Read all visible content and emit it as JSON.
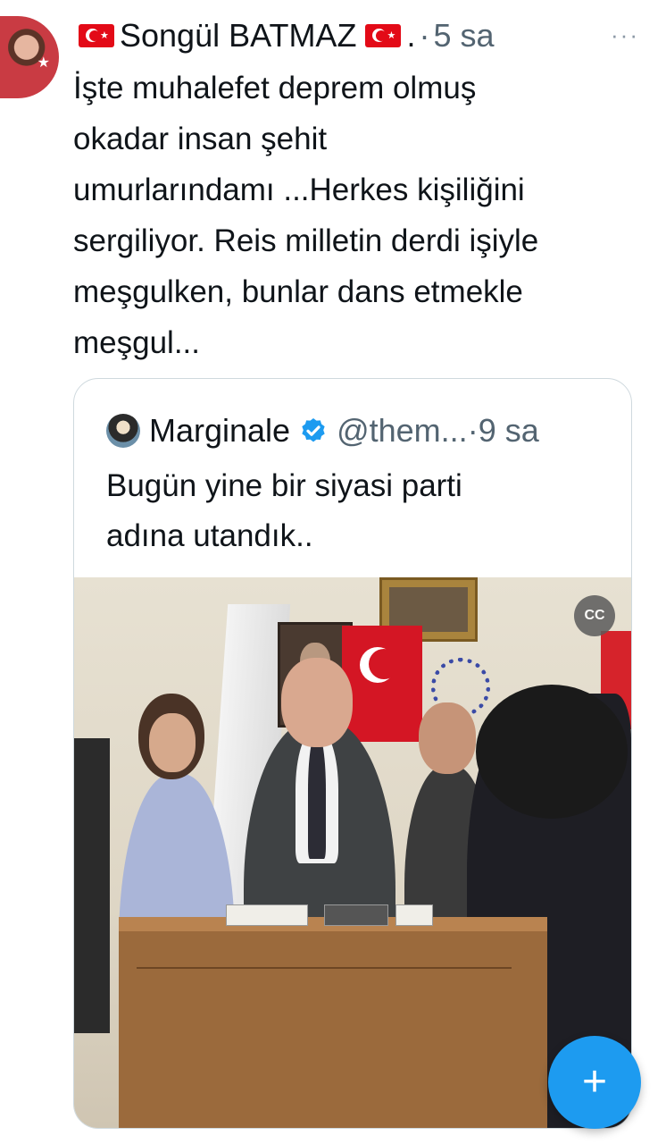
{
  "tweet": {
    "author_name": "Songül BATMAZ",
    "author_suffix": ".",
    "separator": "·",
    "time": "5 sa",
    "more_label": "···",
    "text": "İşte muhalefet  deprem olmuş\nokadar insan şehit\numurlarındamı ...Herkes kişiliğini\nsergiliyor. Reis milletin derdi işiyle\nmeşgulken, bunlar dans etmekle\nmeşgul..."
  },
  "quote": {
    "author_name": "Marginale",
    "handle": "@them...",
    "separator": "·",
    "time": "9 sa",
    "text": "Bugün yine bir siyasi parti\nadına utandık.."
  },
  "fab": {
    "label": "+"
  },
  "colors": {
    "accent": "#1d9bf0",
    "secondary_text": "#536471",
    "flag_red": "#e30a17"
  },
  "icons": [
    "turkish-flag-icon",
    "more-icon",
    "verified-icon",
    "captions-icon",
    "compose-icon"
  ]
}
